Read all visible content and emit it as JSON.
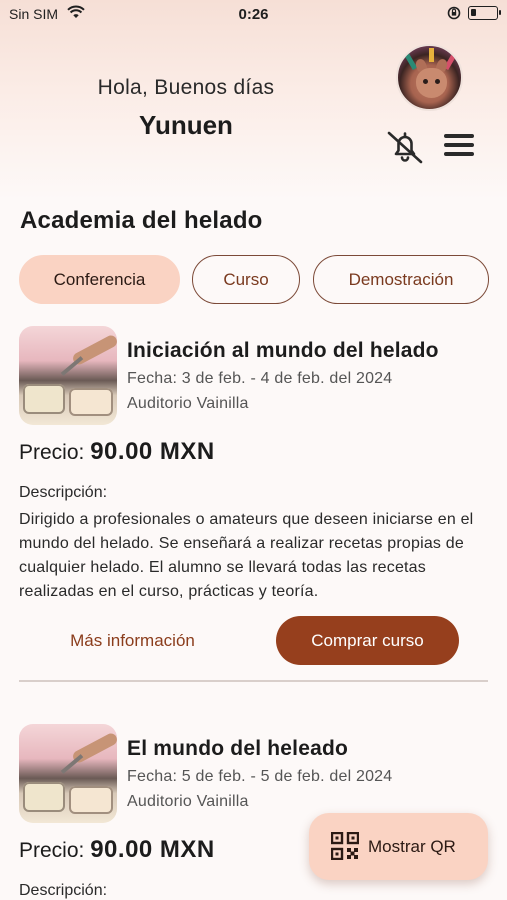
{
  "status_bar": {
    "carrier": "Sin SIM",
    "time": "0:26",
    "wifi_icon": "wifi-icon",
    "rotation_lock_icon": "rotation-lock-icon",
    "battery_icon": "battery-icon"
  },
  "header": {
    "greeting": "Hola, Buenos días",
    "username": "Yunuen",
    "avatar_icon": "avatar",
    "notifications_icon": "bell-off-icon",
    "menu_icon": "menu-icon"
  },
  "section_title": "Academia del helado",
  "filters": {
    "chips": [
      {
        "label": "Conferencia",
        "active": true
      },
      {
        "label": "Curso",
        "active": false
      },
      {
        "label": "Demostración",
        "active": false
      }
    ]
  },
  "courses": [
    {
      "title": "Iniciación al mundo del helado",
      "date": "Fecha: 3 de feb. - 4 de feb. del 2024",
      "place": "Auditorio Vainilla",
      "price_label": "Precio:",
      "price_value": "90.00 MXN",
      "description_label": "Descripción:",
      "description": "Dirigido a profesionales o amateurs que deseen iniciarse en el mundo del helado. Se enseñará a realizar recetas propias de cualquier helado. El alumno se llevará todas las recetas realizadas en el curso, prácticas y teoría.",
      "more_info_label": "Más información",
      "buy_label": "Comprar curso"
    },
    {
      "title": "El mundo del heleado",
      "date": "Fecha: 5 de feb. - 5 de feb. del 2024",
      "place": "Auditorio Vainilla",
      "price_label": "Precio:",
      "price_value": "90.00 MXN",
      "description_label": "Descripción:"
    }
  ],
  "fab": {
    "label": "Mostrar QR",
    "icon": "qr-code-icon"
  },
  "colors": {
    "accent": "#963f1d",
    "chip_active_bg": "#fad3c3",
    "text": "#1c1c1c"
  }
}
